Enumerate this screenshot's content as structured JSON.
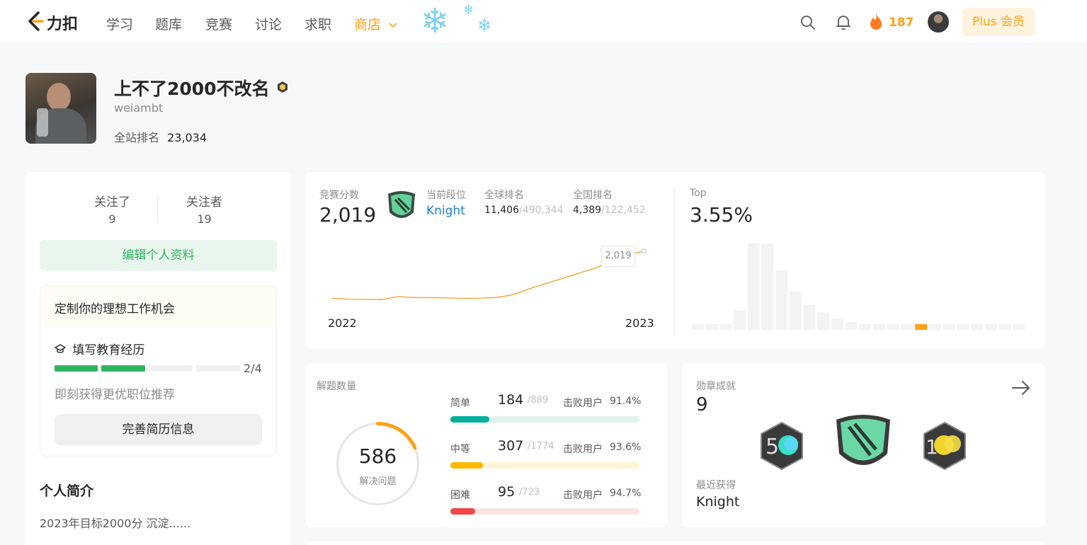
{
  "nav": {
    "brand": "力扣",
    "items": [
      "学习",
      "题库",
      "竞赛",
      "讨论",
      "求职"
    ],
    "store": "商店",
    "streak": "187",
    "plus": "Plus 会员"
  },
  "profile": {
    "name": "上不了2000不改名",
    "username": "weiambt",
    "rank_label": "全站排名",
    "rank": "23,034"
  },
  "sidebar": {
    "following_label": "关注了",
    "following": "9",
    "followers_label": "关注者",
    "followers": "19",
    "edit_button": "编辑个人资料",
    "job_title": "定制你的理想工作机会",
    "edu_task": "填写教育经历",
    "progress_text": "2/4",
    "progress_fraction": 0.5,
    "job_hint": "即刻获得更优职位推荐",
    "resume_button": "完善简历信息",
    "bio_title": "个人简介",
    "bio": "2023年目标2000分 沉淀......"
  },
  "contest": {
    "score_label": "竞赛分数",
    "score": "2,019",
    "tier_label": "当前段位",
    "tier": "Knight",
    "global_label": "全球排名",
    "global_rank": "11,406",
    "global_total": "/490,344",
    "national_label": "全国排名",
    "national_rank": "4,389",
    "national_total": "/122,452",
    "tooltip": "2,019",
    "x_start": "2022",
    "x_end": "2023",
    "top_label": "Top",
    "top_value": "3.55%"
  },
  "chart_data": [
    {
      "type": "line",
      "x": [
        "2022",
        "",
        "",
        "",
        "",
        "",
        "",
        "",
        "",
        "",
        "",
        "",
        "",
        "",
        "",
        "",
        "",
        "",
        "",
        "2023"
      ],
      "values": [
        1470,
        1460,
        1458,
        1455,
        1490,
        1480,
        1478,
        1475,
        1470,
        1472,
        1480,
        1510,
        1580,
        1640,
        1700,
        1760,
        1820,
        1900,
        1980,
        2019
      ],
      "highlight": "2,019",
      "color": "#f0a020"
    },
    {
      "type": "bar",
      "values": [
        3,
        3,
        3,
        10,
        45,
        45,
        31,
        20,
        13,
        9,
        6,
        4,
        3,
        3,
        3,
        3,
        3,
        3,
        3,
        3,
        3,
        3,
        3,
        3
      ],
      "highlight_index": 16,
      "highlight_color": "#ffa116",
      "color": "#f2f3f5"
    }
  ],
  "solved": {
    "title": "解题数量",
    "total": "586",
    "total_label": "解决问题",
    "beat_label": "击败用户",
    "rows": [
      {
        "label": "简单",
        "count": "184",
        "total": "/889",
        "beat": "91.4%",
        "fraction": 0.207,
        "color": "#00af9b",
        "bg": "#e0f3ea"
      },
      {
        "label": "中等",
        "count": "307",
        "total": "/1774",
        "beat": "93.6%",
        "fraction": 0.173,
        "color": "#ffb800",
        "bg": "#fff3d8"
      },
      {
        "label": "困难",
        "count": "95",
        "total": "/723",
        "beat": "94.7%",
        "fraction": 0.131,
        "color": "#ef4743",
        "bg": "#fde3e3"
      }
    ]
  },
  "badges": {
    "title": "勋章成就",
    "count": "9",
    "recent_label": "最近获得",
    "recent": "Knight"
  },
  "colors": {
    "accent": "#ffa116",
    "green": "#2db55d",
    "blue": "#1a7fd4"
  }
}
